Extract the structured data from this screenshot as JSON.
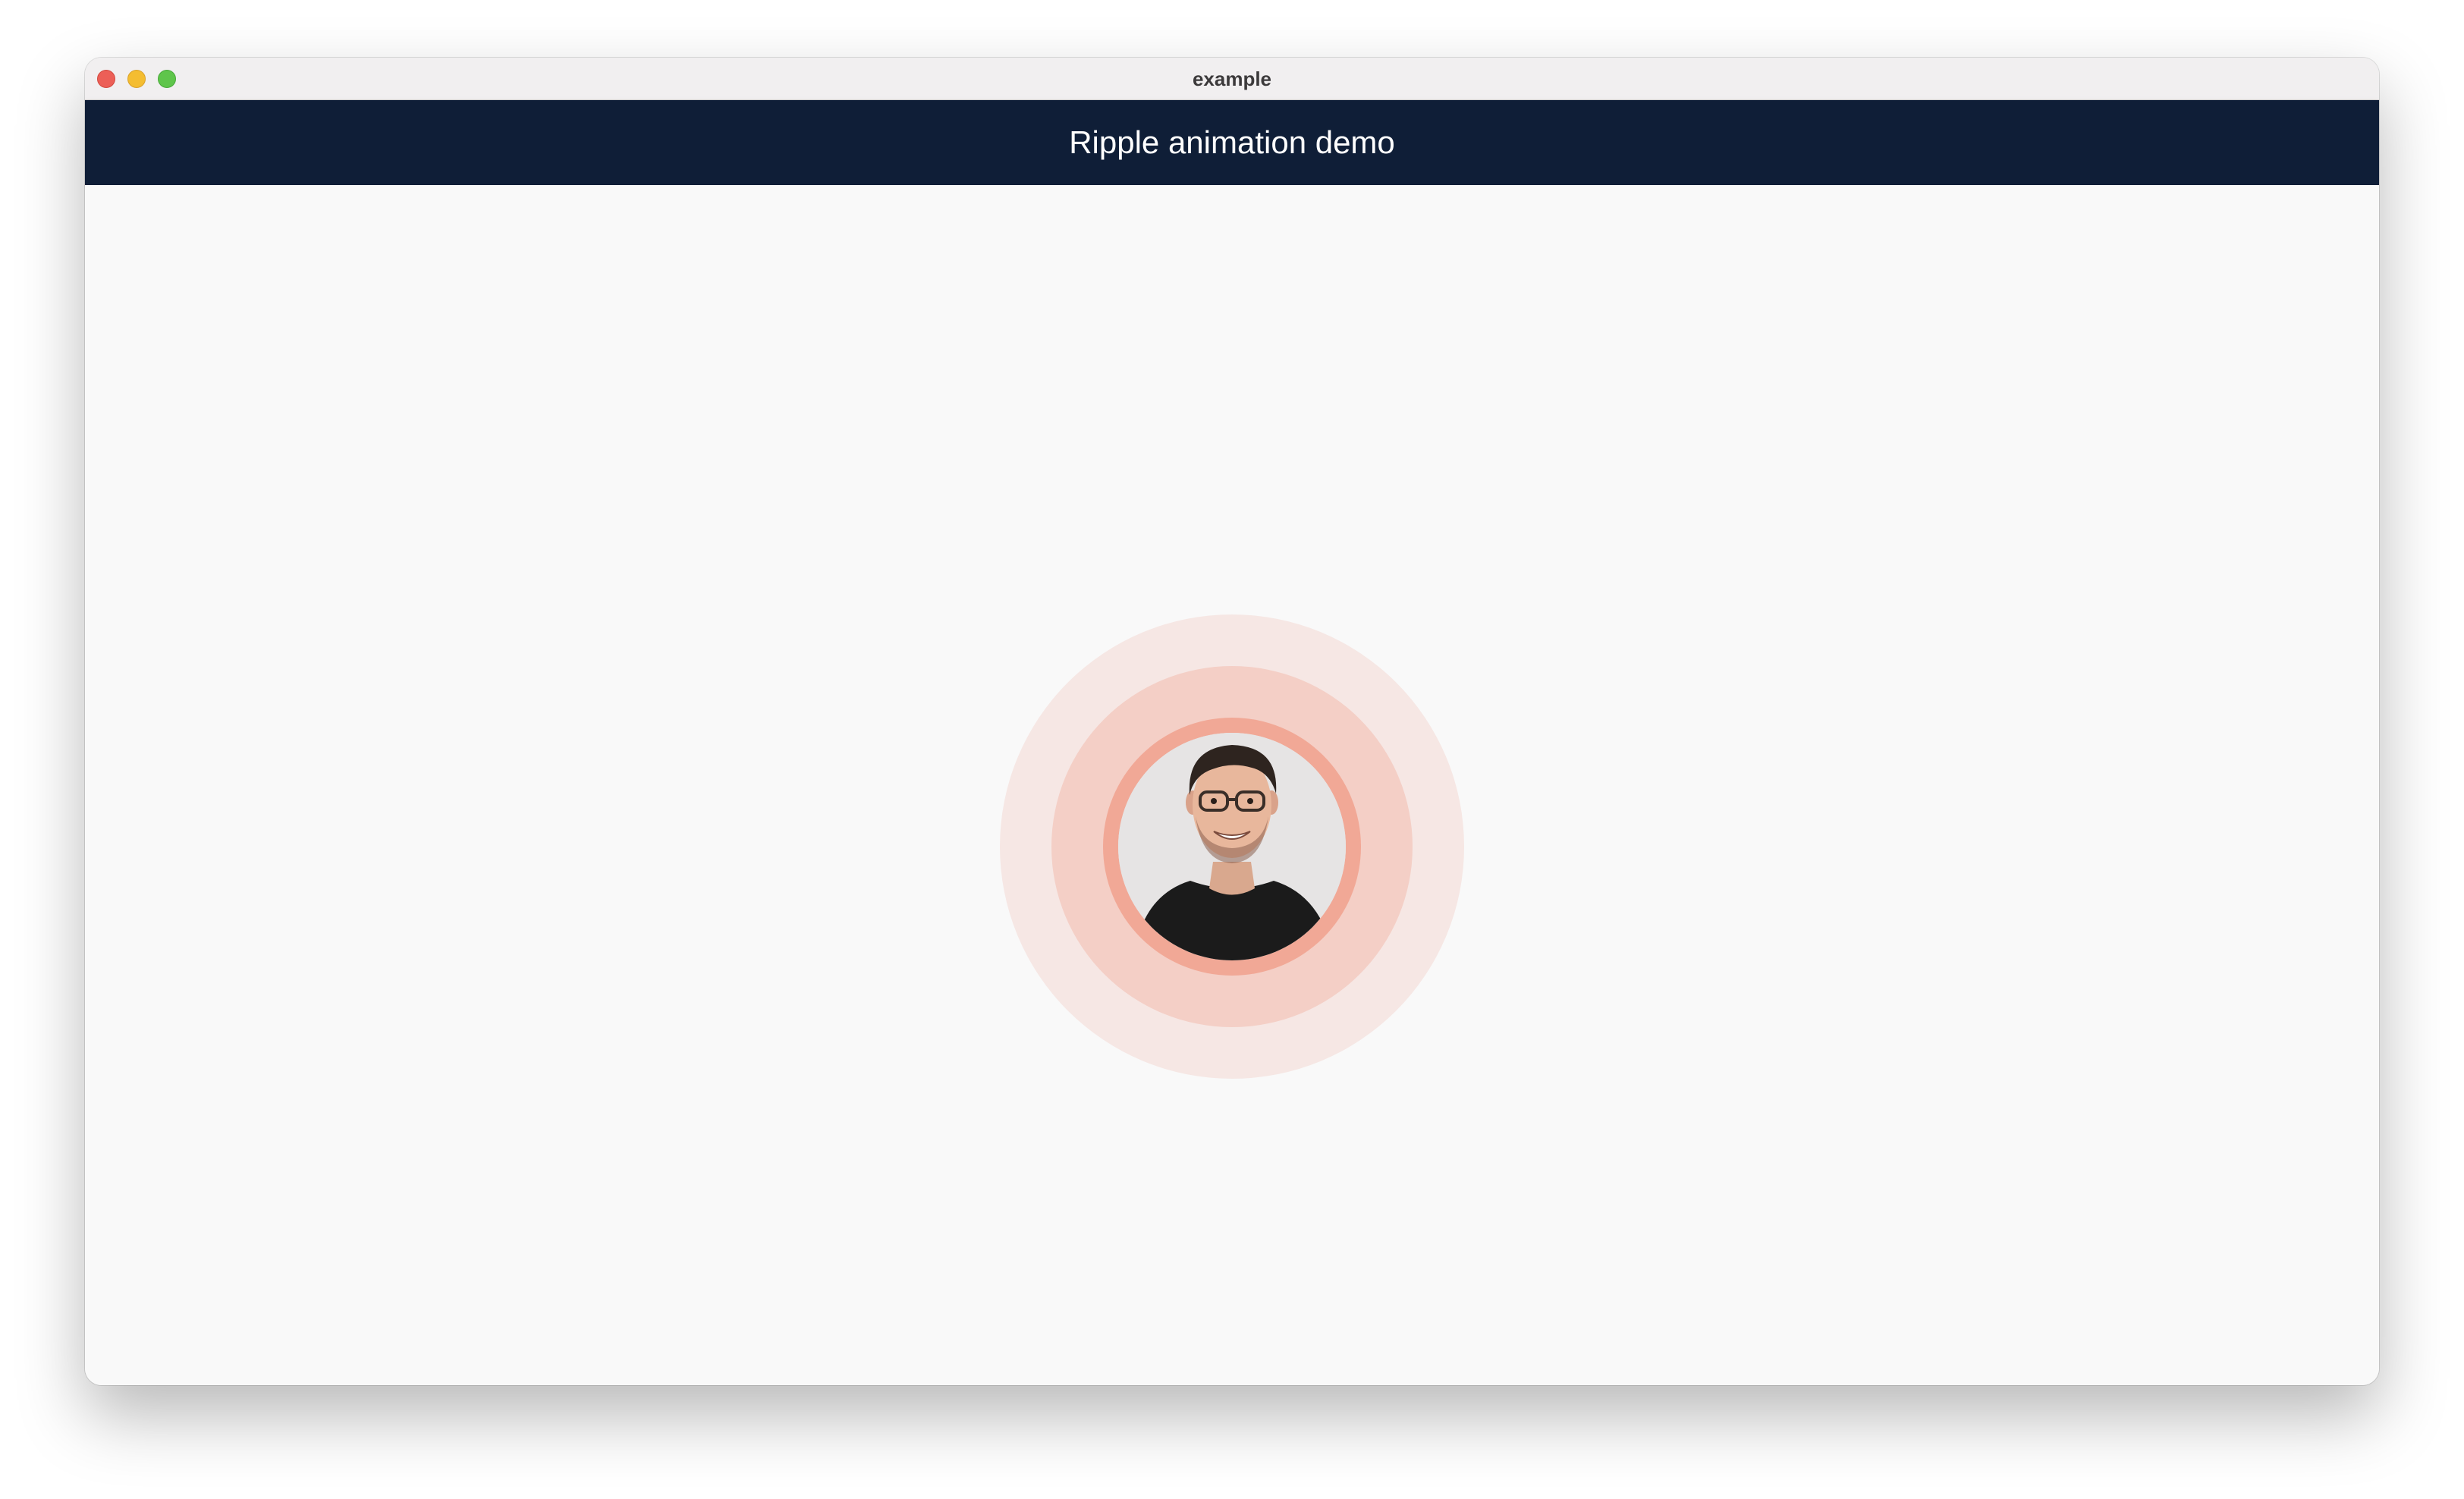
{
  "window": {
    "title": "example"
  },
  "appbar": {
    "title": "Ripple animation demo"
  },
  "ripple": {
    "colors": {
      "outer": "#f6e7e4",
      "middle": "#f4cfc6",
      "inner": "#f1a896"
    },
    "avatar_icon": "person-photo"
  },
  "fab": {
    "icon": "plus-icon",
    "label": "+"
  },
  "colors": {
    "primary": "#0f1e37",
    "background": "#f9f9f9"
  }
}
